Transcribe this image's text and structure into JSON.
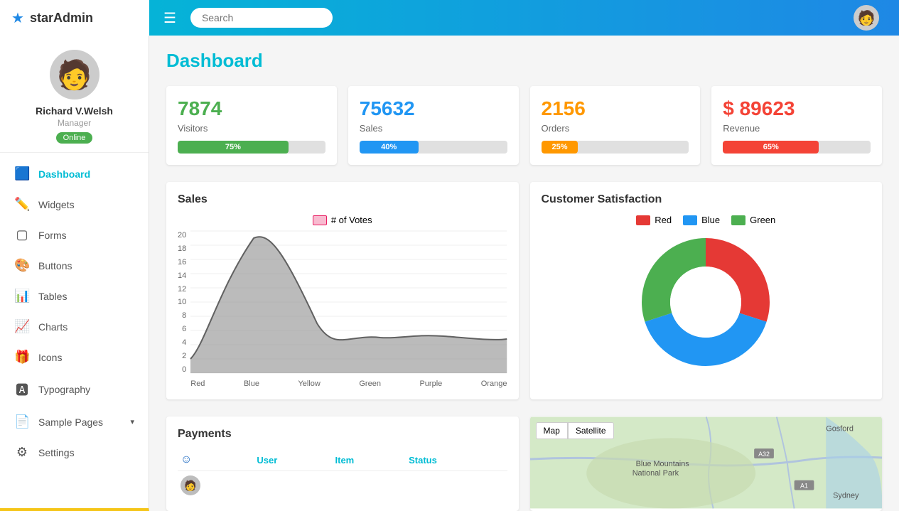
{
  "brand": {
    "name": "starAdmin",
    "star_icon": "★"
  },
  "navbar": {
    "search_placeholder": "Search",
    "grid_icon": "⊞"
  },
  "profile": {
    "name": "Richard V.Welsh",
    "role": "Manager",
    "status": "Online"
  },
  "nav": {
    "items": [
      {
        "id": "dashboard",
        "label": "Dashboard",
        "icon": "🟦",
        "active": true
      },
      {
        "id": "widgets",
        "label": "Widgets",
        "icon": "✏️",
        "active": false
      },
      {
        "id": "forms",
        "label": "Forms",
        "icon": "▢",
        "active": false
      },
      {
        "id": "buttons",
        "label": "Buttons",
        "icon": "🎨",
        "active": false
      },
      {
        "id": "tables",
        "label": "Tables",
        "icon": "📊",
        "active": false
      },
      {
        "id": "charts",
        "label": "Charts",
        "icon": "📈",
        "active": false
      },
      {
        "id": "icons",
        "label": "Icons",
        "icon": "🎁",
        "active": false
      },
      {
        "id": "typography",
        "label": "Typography",
        "icon": "🅰",
        "active": false
      },
      {
        "id": "sample-pages",
        "label": "Sample Pages",
        "icon": "📄",
        "arrow": "▾",
        "active": false
      },
      {
        "id": "settings",
        "label": "Settings",
        "icon": "⚙",
        "active": false
      }
    ]
  },
  "page": {
    "title": "Dashboard"
  },
  "stats": [
    {
      "id": "visitors",
      "value": "7874",
      "label": "Visitors",
      "progress": 75,
      "color": "#4caf50"
    },
    {
      "id": "sales",
      "value": "75632",
      "label": "Sales",
      "progress": 40,
      "color": "#2196f3"
    },
    {
      "id": "orders",
      "value": "2156",
      "label": "Orders",
      "progress": 25,
      "color": "#ff9800"
    },
    {
      "id": "revenue",
      "value": "$ 89623",
      "label": "Revenue",
      "progress": 65,
      "color": "#f44336"
    }
  ],
  "stats_colors": [
    "#4caf50",
    "#2196f3",
    "#ff9800",
    "#f44336"
  ],
  "sales_chart": {
    "title": "Sales",
    "legend_label": "# of Votes",
    "x_labels": [
      "Red",
      "Blue",
      "Yellow",
      "Green",
      "Purple",
      "Orange"
    ],
    "y_labels": [
      "20",
      "18",
      "16",
      "14",
      "12",
      "10",
      "8",
      "6",
      "4",
      "2",
      "0"
    ]
  },
  "satisfaction_chart": {
    "title": "Customer Satisfaction",
    "legend": [
      {
        "label": "Red",
        "color": "#e53935"
      },
      {
        "label": "Blue",
        "color": "#2196f3"
      },
      {
        "label": "Green",
        "color": "#4caf50"
      }
    ],
    "segments": [
      {
        "label": "Red",
        "value": 30,
        "color": "#e53935"
      },
      {
        "label": "Blue",
        "value": 40,
        "color": "#2196f3"
      },
      {
        "label": "Green",
        "value": 30,
        "color": "#4caf50"
      }
    ]
  },
  "payments": {
    "title": "Payments",
    "headers": [
      "",
      "User",
      "Item",
      "Status"
    ],
    "rows": []
  },
  "map": {
    "title": "Map",
    "controls": [
      "Map",
      "Satellite"
    ],
    "location_text": "Blue Mountains National Park",
    "city_text": "Gosford",
    "city2_text": "Sydney"
  }
}
